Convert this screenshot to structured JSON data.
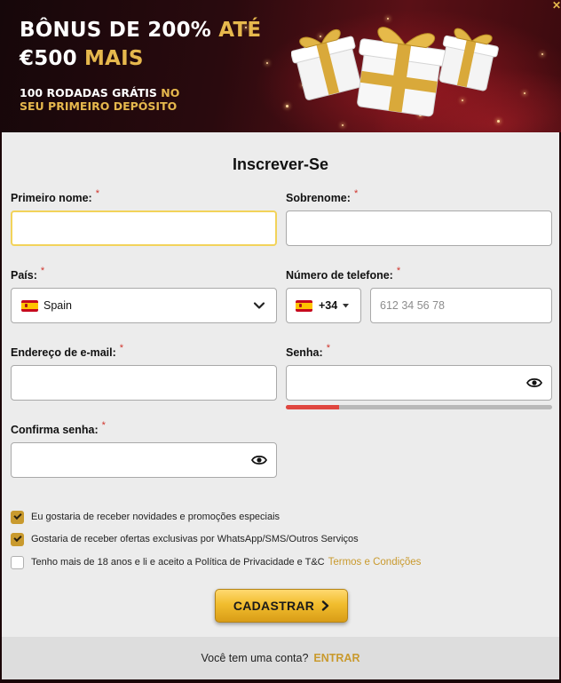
{
  "banner": {
    "title_line1_white": "BÔNUS DE 200%",
    "title_line1_gold": "ATÉ",
    "title_line2_white": "€500",
    "title_line2_gold": "MAIS",
    "sub_white_1": "100 RODADAS GRÁTIS",
    "sub_gold_1": "NO",
    "sub_gold_2": "SEU PRIMEIRO DEPÓSITO"
  },
  "form": {
    "title": "Inscrever-Se",
    "required_mark": "*",
    "first_name": {
      "label": "Primeiro nome:",
      "value": ""
    },
    "last_name": {
      "label": "Sobrenome:",
      "value": ""
    },
    "country": {
      "label": "País:",
      "value": "Spain"
    },
    "phone": {
      "label": "Número de telefone:",
      "code": "+34",
      "placeholder": "612 34 56 78"
    },
    "email": {
      "label": "Endereço de e-mail:",
      "value": ""
    },
    "password": {
      "label": "Senha:",
      "value": "",
      "strength": 0.2
    },
    "confirm_password": {
      "label": "Confirma senha:",
      "value": ""
    },
    "checkboxes": [
      {
        "label": "Eu gostaria de receber novidades e promoções especiais",
        "checked": true
      },
      {
        "label": "Gostaria de receber ofertas exclusivas por WhatsApp/SMS/Outros Serviços",
        "checked": true
      },
      {
        "label": "Tenho mais de 18 anos e li e aceito a Política de Privacidade e T&C",
        "checked": false,
        "link": "Termos e Condições"
      }
    ],
    "submit_label": "CADASTRAR"
  },
  "footer": {
    "prompt": "Você tem uma conta?",
    "login_label": "ENTRAR"
  },
  "colors": {
    "accent_gold": "#c99a2e",
    "required_red": "#d0342c",
    "focus_yellow": "#f2d35a"
  }
}
